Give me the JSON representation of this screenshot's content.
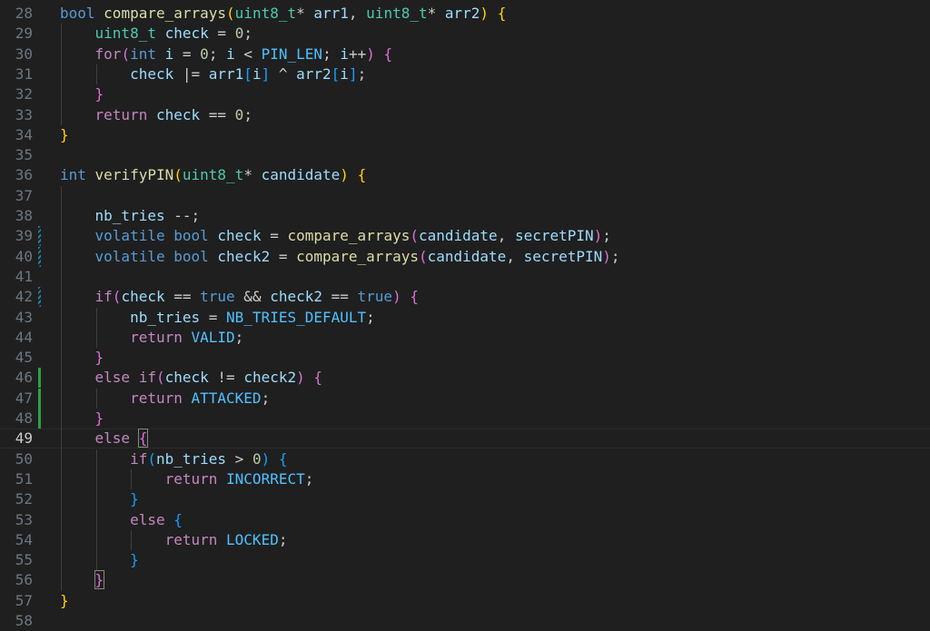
{
  "editor": {
    "current_line": "49",
    "lines": [
      {
        "num": "28",
        "gutter": "",
        "tokens": [
          [
            "kw",
            "bool"
          ],
          [
            "p",
            " "
          ],
          [
            "fn",
            "compare_arrays"
          ],
          [
            "b1",
            "("
          ],
          [
            "type",
            "uint8_t"
          ],
          [
            "p",
            "* "
          ],
          [
            "var",
            "arr1"
          ],
          [
            "p",
            ", "
          ],
          [
            "type",
            "uint8_t"
          ],
          [
            "p",
            "* "
          ],
          [
            "var",
            "arr2"
          ],
          [
            "b1",
            ")"
          ],
          [
            "p",
            " "
          ],
          [
            "b1",
            "{"
          ]
        ]
      },
      {
        "num": "29",
        "gutter": "",
        "tokens": [
          [
            "p",
            "    "
          ],
          [
            "type",
            "uint8_t"
          ],
          [
            "p",
            " "
          ],
          [
            "var",
            "check"
          ],
          [
            "p",
            " = "
          ],
          [
            "num",
            "0"
          ],
          [
            "p",
            ";"
          ]
        ]
      },
      {
        "num": "30",
        "gutter": "",
        "tokens": [
          [
            "p",
            "    "
          ],
          [
            "ctrl",
            "for"
          ],
          [
            "b2",
            "("
          ],
          [
            "kw",
            "int"
          ],
          [
            "p",
            " "
          ],
          [
            "var",
            "i"
          ],
          [
            "p",
            " = "
          ],
          [
            "num",
            "0"
          ],
          [
            "p",
            "; "
          ],
          [
            "var",
            "i"
          ],
          [
            "p",
            " < "
          ],
          [
            "const",
            "PIN_LEN"
          ],
          [
            "p",
            "; "
          ],
          [
            "var",
            "i"
          ],
          [
            "p",
            "++"
          ],
          [
            "b2",
            ")"
          ],
          [
            "p",
            " "
          ],
          [
            "b2",
            "{"
          ]
        ]
      },
      {
        "num": "31",
        "gutter": "",
        "tokens": [
          [
            "p",
            "        "
          ],
          [
            "var",
            "check"
          ],
          [
            "p",
            " |= "
          ],
          [
            "var",
            "arr1"
          ],
          [
            "b3",
            "["
          ],
          [
            "var",
            "i"
          ],
          [
            "b3",
            "]"
          ],
          [
            "p",
            " ^ "
          ],
          [
            "var",
            "arr2"
          ],
          [
            "b3",
            "["
          ],
          [
            "var",
            "i"
          ],
          [
            "b3",
            "]"
          ],
          [
            "p",
            ";"
          ]
        ]
      },
      {
        "num": "32",
        "gutter": "",
        "tokens": [
          [
            "p",
            "    "
          ],
          [
            "b2",
            "}"
          ]
        ]
      },
      {
        "num": "33",
        "gutter": "",
        "tokens": [
          [
            "p",
            "    "
          ],
          [
            "ctrl",
            "return"
          ],
          [
            "p",
            " "
          ],
          [
            "var",
            "check"
          ],
          [
            "p",
            " == "
          ],
          [
            "num",
            "0"
          ],
          [
            "p",
            ";"
          ]
        ]
      },
      {
        "num": "34",
        "gutter": "",
        "tokens": [
          [
            "b1",
            "}"
          ]
        ]
      },
      {
        "num": "35",
        "gutter": "",
        "tokens": []
      },
      {
        "num": "36",
        "gutter": "",
        "tokens": [
          [
            "kw",
            "int"
          ],
          [
            "p",
            " "
          ],
          [
            "fn",
            "verifyPIN"
          ],
          [
            "b1",
            "("
          ],
          [
            "type",
            "uint8_t"
          ],
          [
            "p",
            "* "
          ],
          [
            "var",
            "candidate"
          ],
          [
            "b1",
            ")"
          ],
          [
            "p",
            " "
          ],
          [
            "b1",
            "{"
          ]
        ]
      },
      {
        "num": "37",
        "gutter": "",
        "tokens": []
      },
      {
        "num": "38",
        "gutter": "",
        "tokens": [
          [
            "p",
            "    "
          ],
          [
            "var",
            "nb_tries"
          ],
          [
            "p",
            " --;"
          ]
        ]
      },
      {
        "num": "39",
        "gutter": "modified",
        "tokens": [
          [
            "p",
            "    "
          ],
          [
            "kw",
            "volatile"
          ],
          [
            "p",
            " "
          ],
          [
            "kw",
            "bool"
          ],
          [
            "p",
            " "
          ],
          [
            "var",
            "check"
          ],
          [
            "p",
            " = "
          ],
          [
            "fn",
            "compare_arrays"
          ],
          [
            "b2",
            "("
          ],
          [
            "var",
            "candidate"
          ],
          [
            "p",
            ", "
          ],
          [
            "var",
            "secretPIN"
          ],
          [
            "b2",
            ")"
          ],
          [
            "p",
            ";"
          ]
        ]
      },
      {
        "num": "40",
        "gutter": "modified",
        "tokens": [
          [
            "p",
            "    "
          ],
          [
            "kw",
            "volatile"
          ],
          [
            "p",
            " "
          ],
          [
            "kw",
            "bool"
          ],
          [
            "p",
            " "
          ],
          [
            "var",
            "check2"
          ],
          [
            "p",
            " = "
          ],
          [
            "fn",
            "compare_arrays"
          ],
          [
            "b2",
            "("
          ],
          [
            "var",
            "candidate"
          ],
          [
            "p",
            ", "
          ],
          [
            "var",
            "secretPIN"
          ],
          [
            "b2",
            ")"
          ],
          [
            "p",
            ";"
          ]
        ]
      },
      {
        "num": "41",
        "gutter": "",
        "tokens": []
      },
      {
        "num": "42",
        "gutter": "modified",
        "tokens": [
          [
            "p",
            "    "
          ],
          [
            "ctrl",
            "if"
          ],
          [
            "b2",
            "("
          ],
          [
            "var",
            "check"
          ],
          [
            "p",
            " == "
          ],
          [
            "kw",
            "true"
          ],
          [
            "p",
            " && "
          ],
          [
            "var",
            "check2"
          ],
          [
            "p",
            " == "
          ],
          [
            "kw",
            "true"
          ],
          [
            "b2",
            ")"
          ],
          [
            "p",
            " "
          ],
          [
            "b2",
            "{"
          ]
        ]
      },
      {
        "num": "43",
        "gutter": "",
        "tokens": [
          [
            "p",
            "        "
          ],
          [
            "var",
            "nb_tries"
          ],
          [
            "p",
            " = "
          ],
          [
            "const",
            "NB_TRIES_DEFAULT"
          ],
          [
            "p",
            ";"
          ]
        ]
      },
      {
        "num": "44",
        "gutter": "",
        "tokens": [
          [
            "p",
            "        "
          ],
          [
            "ctrl",
            "return"
          ],
          [
            "p",
            " "
          ],
          [
            "const",
            "VALID"
          ],
          [
            "p",
            ";"
          ]
        ]
      },
      {
        "num": "45",
        "gutter": "",
        "tokens": [
          [
            "p",
            "    "
          ],
          [
            "b2",
            "}"
          ]
        ]
      },
      {
        "num": "46",
        "gutter": "added",
        "tokens": [
          [
            "p",
            "    "
          ],
          [
            "ctrl",
            "else"
          ],
          [
            "p",
            " "
          ],
          [
            "ctrl",
            "if"
          ],
          [
            "b2",
            "("
          ],
          [
            "var",
            "check"
          ],
          [
            "p",
            " != "
          ],
          [
            "var",
            "check2"
          ],
          [
            "b2",
            ")"
          ],
          [
            "p",
            " "
          ],
          [
            "b2",
            "{"
          ]
        ]
      },
      {
        "num": "47",
        "gutter": "added",
        "tokens": [
          [
            "p",
            "        "
          ],
          [
            "ctrl",
            "return"
          ],
          [
            "p",
            " "
          ],
          [
            "const",
            "ATTACKED"
          ],
          [
            "p",
            ";"
          ]
        ]
      },
      {
        "num": "48",
        "gutter": "added",
        "tokens": [
          [
            "p",
            "    "
          ],
          [
            "b2",
            "}"
          ]
        ]
      },
      {
        "num": "49",
        "gutter": "",
        "tokens": [
          [
            "p",
            "    "
          ],
          [
            "ctrl",
            "else"
          ],
          [
            "p",
            " "
          ],
          [
            "b2",
            "{"
          ]
        ]
      },
      {
        "num": "50",
        "gutter": "",
        "tokens": [
          [
            "p",
            "        "
          ],
          [
            "ctrl",
            "if"
          ],
          [
            "b3",
            "("
          ],
          [
            "var",
            "nb_tries"
          ],
          [
            "p",
            " > "
          ],
          [
            "num",
            "0"
          ],
          [
            "b3",
            ")"
          ],
          [
            "p",
            " "
          ],
          [
            "b3",
            "{"
          ]
        ]
      },
      {
        "num": "51",
        "gutter": "",
        "tokens": [
          [
            "p",
            "            "
          ],
          [
            "ctrl",
            "return"
          ],
          [
            "p",
            " "
          ],
          [
            "const",
            "INCORRECT"
          ],
          [
            "p",
            ";"
          ]
        ]
      },
      {
        "num": "52",
        "gutter": "",
        "tokens": [
          [
            "p",
            "        "
          ],
          [
            "b3",
            "}"
          ]
        ]
      },
      {
        "num": "53",
        "gutter": "",
        "tokens": [
          [
            "p",
            "        "
          ],
          [
            "ctrl",
            "else"
          ],
          [
            "p",
            " "
          ],
          [
            "b3",
            "{"
          ]
        ]
      },
      {
        "num": "54",
        "gutter": "",
        "tokens": [
          [
            "p",
            "            "
          ],
          [
            "ctrl",
            "return"
          ],
          [
            "p",
            " "
          ],
          [
            "const",
            "LOCKED"
          ],
          [
            "p",
            ";"
          ]
        ]
      },
      {
        "num": "55",
        "gutter": "",
        "tokens": [
          [
            "p",
            "        "
          ],
          [
            "b3",
            "}"
          ]
        ]
      },
      {
        "num": "56",
        "gutter": "",
        "tokens": [
          [
            "p",
            "    "
          ],
          [
            "b2",
            "}"
          ]
        ]
      },
      {
        "num": "57",
        "gutter": "",
        "tokens": [
          [
            "b1",
            "}"
          ]
        ]
      },
      {
        "num": "58",
        "gutter": "",
        "tokens": []
      }
    ]
  },
  "colors": {
    "background": "#1f1f1f",
    "line_number": "#6e7681",
    "gutter_added": "#2ea043",
    "gutter_modified": "#1b81a8"
  }
}
